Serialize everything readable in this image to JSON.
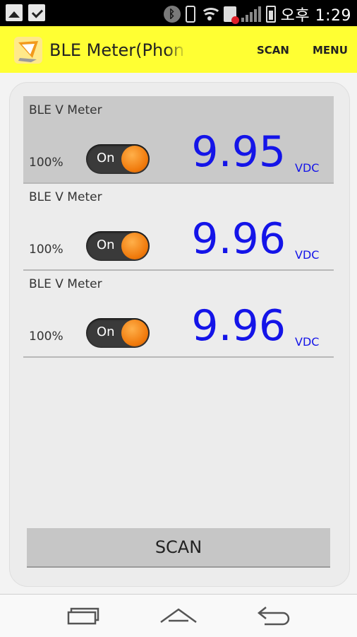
{
  "status_bar": {
    "time": "오후 1:29",
    "left_icons": [
      "image-icon",
      "clipboard-check-icon"
    ],
    "right_icons": [
      "bluetooth-icon",
      "vibrate-icon",
      "wifi-icon",
      "sim-error-icon",
      "signal-icon",
      "battery-charging-icon"
    ]
  },
  "app_bar": {
    "title": "BLE Meter(Phone",
    "logo_icon": "app-logo-icon",
    "actions": [
      "SCAN",
      "MENU"
    ],
    "color": "#ffff33"
  },
  "devices": [
    {
      "name": "BLE V Meter",
      "battery": "100%",
      "toggle": "On",
      "value": "9.95",
      "unit": "VDC",
      "selected": true
    },
    {
      "name": "BLE V Meter",
      "battery": "100%",
      "toggle": "On",
      "value": "9.96",
      "unit": "VDC",
      "selected": false
    },
    {
      "name": "BLE V Meter",
      "battery": "100%",
      "toggle": "On",
      "value": "9.96",
      "unit": "VDC",
      "selected": false
    }
  ],
  "scan_button": "SCAN",
  "nav_bar": {
    "icons": [
      "recent-apps-icon",
      "home-icon",
      "back-icon"
    ]
  },
  "colors": {
    "reading": "#1414e8",
    "toggle_knob": "#f07a0c",
    "selected_row": "#c9c9c9"
  }
}
